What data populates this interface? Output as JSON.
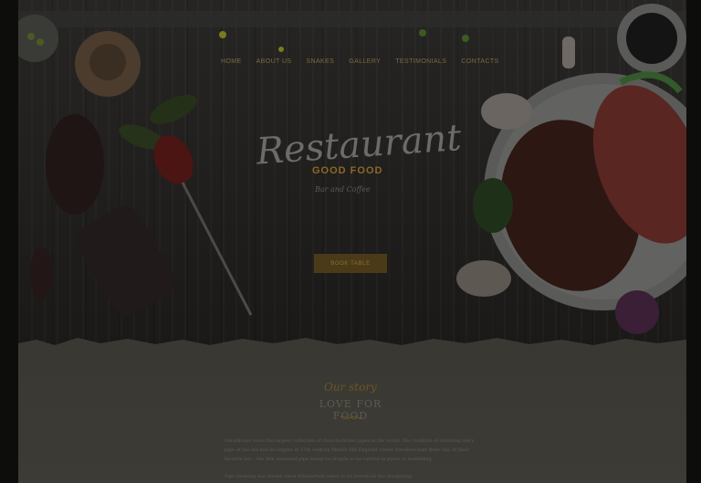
{
  "nav": {
    "items": [
      "HOME",
      "ABOUT US",
      "SNAKES",
      "GALLERY",
      "TESTIMONIALS",
      "CONTACTS"
    ]
  },
  "hero": {
    "script_title": "Restaurant",
    "subtitle": "GOOD FOOD",
    "tagline": "Bar and Coffee",
    "book_button": "BOOK TABLE"
  },
  "story": {
    "script_label": "Our story",
    "title": "LOVE FOR FOOD",
    "paragraph1": "Steakhouse owns the largest collection of churchwarden pipes in the world. The tradition of checking one's pipe at the inn had its origins in 17th century Merrie Old England where travelers kept their clay at their favorite inn – the thin stemmed pipe being too fragile to be carried in purse or saddlebag.",
    "paragraph2": "Pipe smoking was known since Elizabethan times to be beneficial the dissipating "
  },
  "colors": {
    "accent": "#8a6a23",
    "background": "#0d0d0c",
    "wood": "#232221",
    "paper": "#3c3a34"
  }
}
